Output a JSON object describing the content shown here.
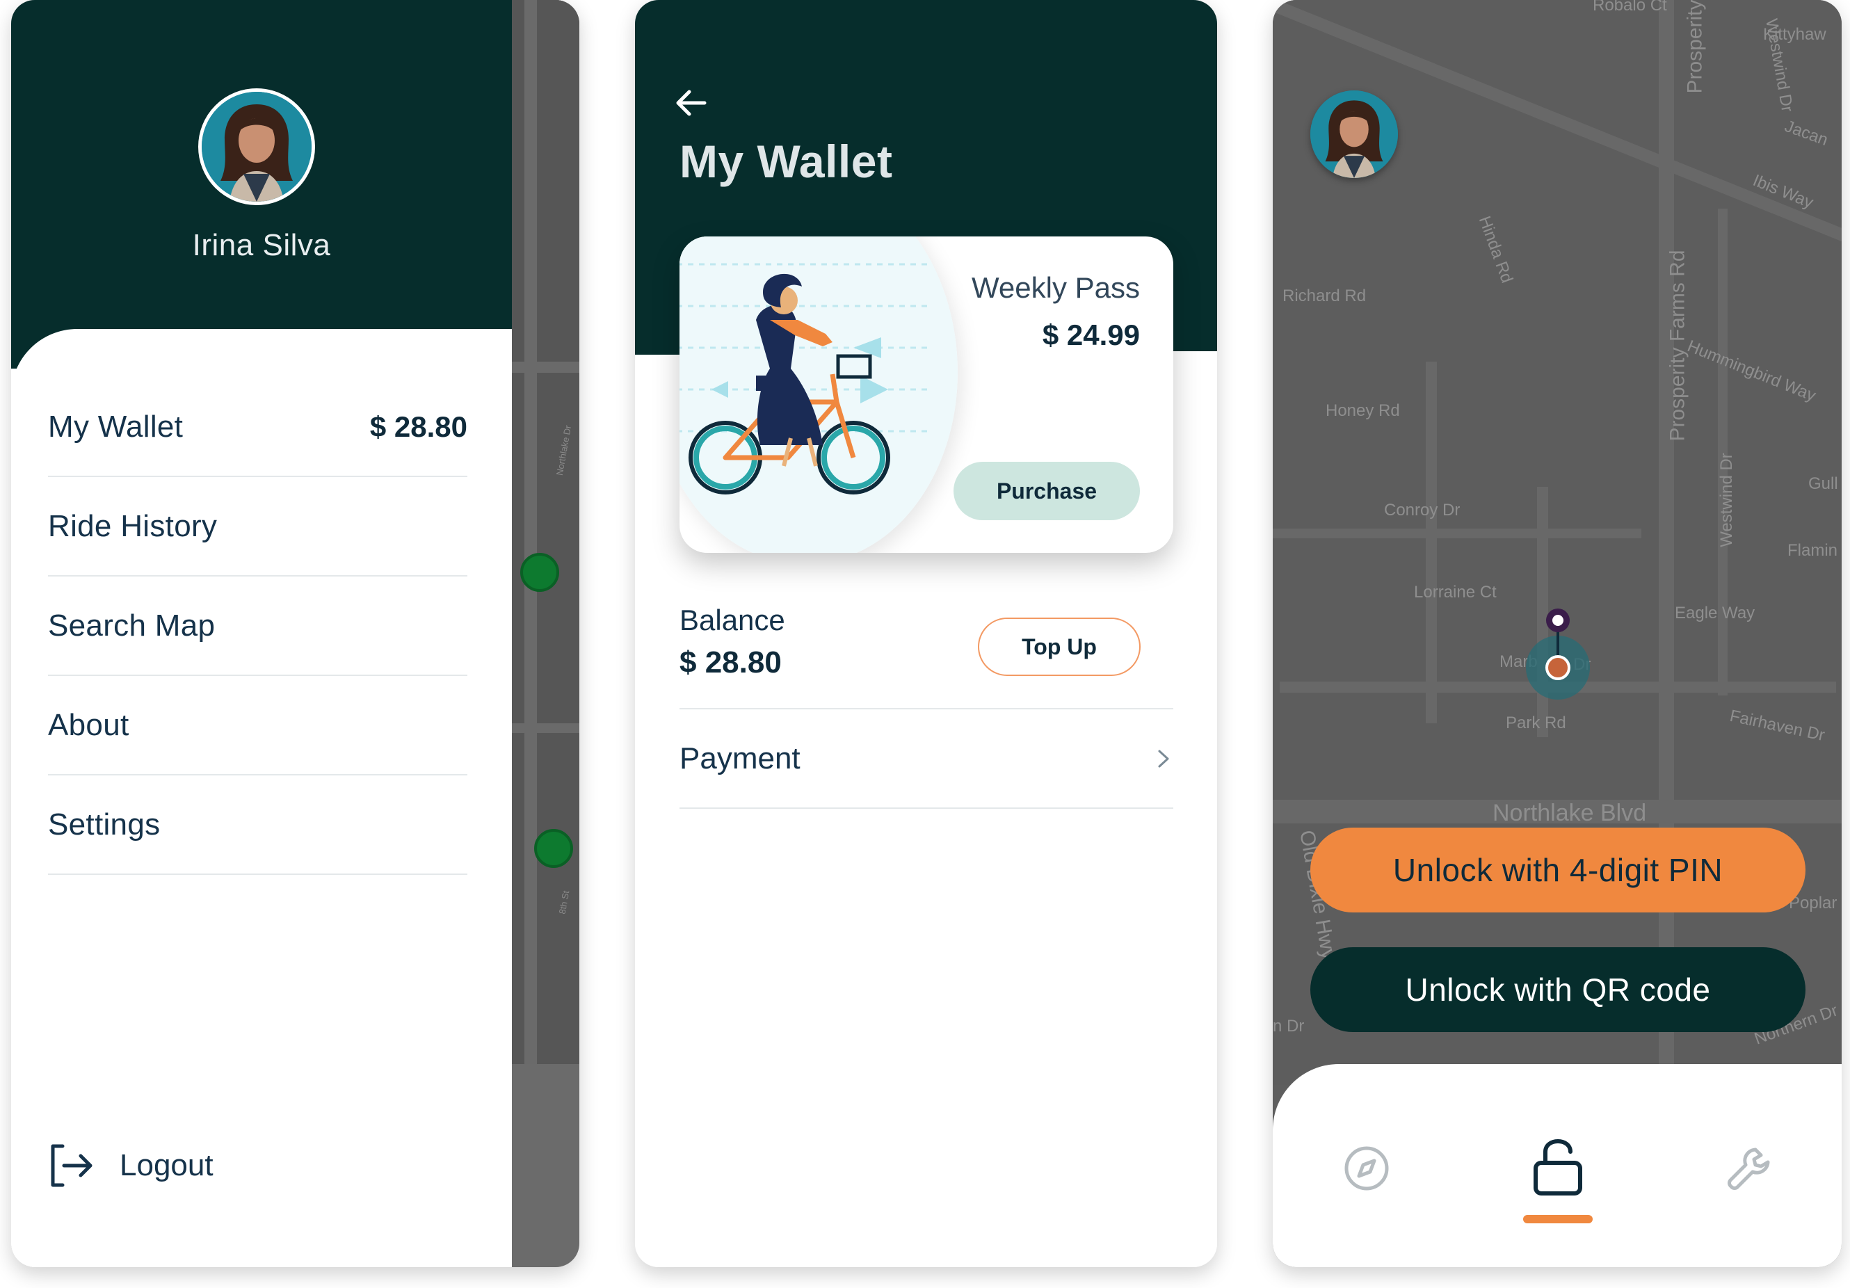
{
  "menu_screen": {
    "user_name": "Irina Silva",
    "items": [
      {
        "label": "My Wallet",
        "value": "$ 28.80"
      },
      {
        "label": "Ride History"
      },
      {
        "label": "Search Map"
      },
      {
        "label": "About"
      },
      {
        "label": "Settings"
      }
    ],
    "logout_label": "Logout"
  },
  "wallet_screen": {
    "title": "My Wallet",
    "pass": {
      "name": "Weekly Pass",
      "price": "$ 24.99",
      "purchase_label": "Purchase"
    },
    "balance_label": "Balance",
    "balance_value": "$ 28.80",
    "topup_label": "Top Up",
    "payment_label": "Payment"
  },
  "map_screen": {
    "streets": [
      "Robalo Ct",
      "Kittyhaw",
      "Westwind Dr",
      "Jacan",
      "Ibis Way",
      "Prosperity",
      "Hinda Rd",
      "Richard Rd",
      "Prosperity Farms Rd",
      "Hummingbird Way",
      "Honey Rd",
      "Gull",
      "Conroy Dr",
      "Westwind Dr",
      "Flamin",
      "Lorraine Ct",
      "Eagle Way",
      "Marb",
      "Dr",
      "Park Rd",
      "Fairhaven Dr",
      "Northlake Blvd",
      "Old Dixie Hwy",
      "Poplar",
      "Northern Dr",
      "n Dr"
    ],
    "unlock_pin_label": "Unlock with 4-digit PIN",
    "unlock_qr_label": "Unlock with QR code",
    "nav": [
      {
        "icon": "compass-icon"
      },
      {
        "icon": "unlock-icon",
        "active": true
      },
      {
        "icon": "wrench-icon"
      }
    ]
  },
  "colors": {
    "dark_teal": "#062d2c",
    "accent_orange": "#f0883f",
    "mint": "#cde6df",
    "marker_green": "#0d7a2f"
  }
}
